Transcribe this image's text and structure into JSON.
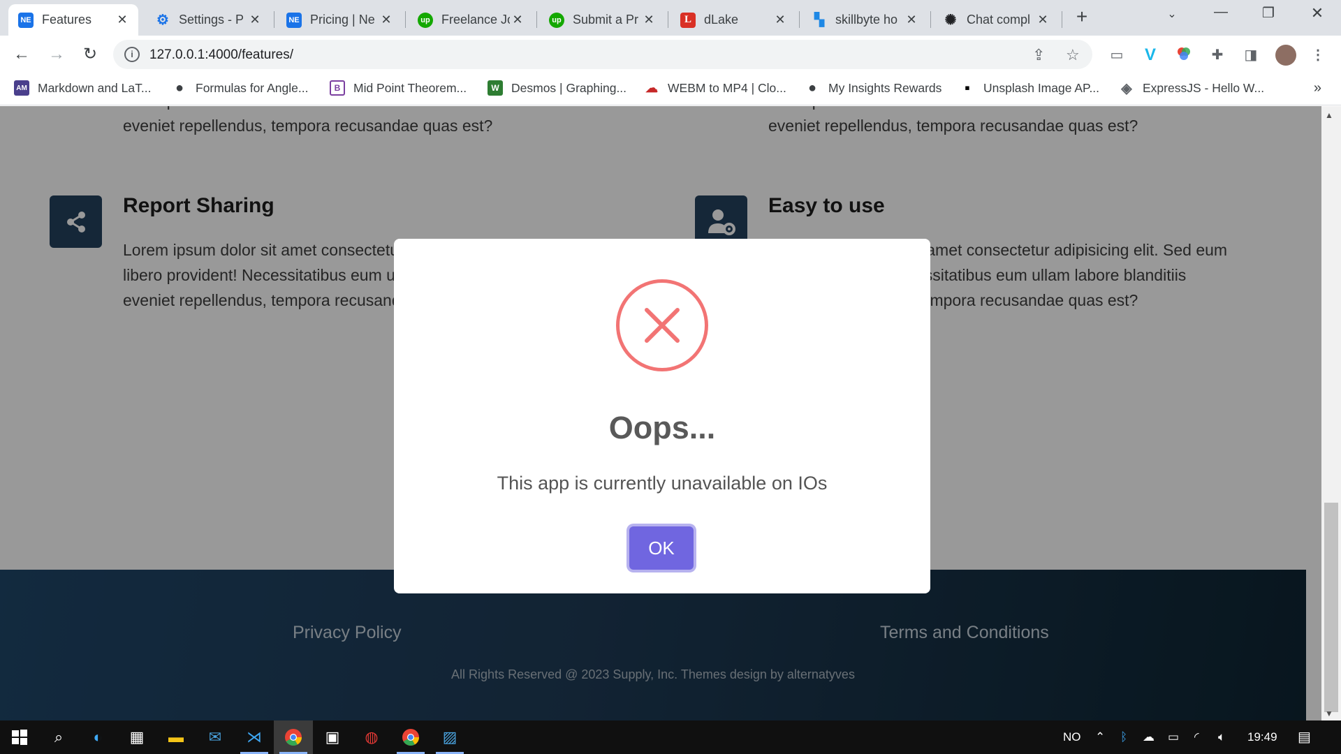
{
  "browser": {
    "tabs": [
      {
        "label": "Features",
        "favicon": "NE",
        "favicon_color": "#1a73e8",
        "active": true
      },
      {
        "label": "Settings - P",
        "favicon": "⚙",
        "favicon_color": "#1a73e8",
        "active": false
      },
      {
        "label": "Pricing | Ne",
        "favicon": "NE",
        "favicon_color": "#1a73e8",
        "active": false
      },
      {
        "label": "Freelance Jo",
        "favicon": "up",
        "favicon_color": "#14a800",
        "active": false
      },
      {
        "label": "Submit a Pr",
        "favicon": "up",
        "favicon_color": "#14a800",
        "active": false
      },
      {
        "label": "dLake",
        "favicon": "L",
        "favicon_color": "#d93025",
        "active": false
      },
      {
        "label": "skillbyte ho",
        "favicon": "▚",
        "favicon_color": "#1e88e5",
        "active": false
      },
      {
        "label": "Chat compl",
        "favicon": "✺",
        "favicon_color": "#202124",
        "active": false
      }
    ],
    "address": "127.0.0.1:4000/features/",
    "bookmarks": [
      {
        "label": "Markdown and LaT...",
        "icon": "AM",
        "icon_color": "#4a3f8c"
      },
      {
        "label": "Formulas for Angle...",
        "icon": "●",
        "icon_color": "#3c4043"
      },
      {
        "label": "Mid Point Theorem...",
        "icon": "B",
        "icon_color": "#7b3fa0"
      },
      {
        "label": "Desmos | Graphing...",
        "icon": "W",
        "icon_color": "#2e7d32"
      },
      {
        "label": "WEBM to MP4 | Clo...",
        "icon": "☁",
        "icon_color": "#c62828"
      },
      {
        "label": "My Insights Rewards",
        "icon": "●",
        "icon_color": "#3c4043"
      },
      {
        "label": "Unsplash Image AP...",
        "icon": "▪",
        "icon_color": "#000000"
      },
      {
        "label": "ExpressJS - Hello W...",
        "icon": "◈",
        "icon_color": "#5f6368"
      }
    ]
  },
  "page": {
    "top_left_partial_line1": "libero provident! Necessitatibus eum ullam labore blanditiis",
    "top_left_partial_line2": "eveniet repellendus, tempora recusandae quas est?",
    "top_right_partial_line1": "libero provident! Necessitatibus eum ullam labore blanditiis",
    "top_right_partial_line2": "eveniet repellendus, tempora recusandae quas est?",
    "features": [
      {
        "title": "Report Sharing",
        "icon": "share-icon",
        "lines": [
          "Lorem ipsum dolor sit amet consectetur adipisicing elit. Sed eum",
          "libero provident! Necessitatibus eum ullam labore blanditiis",
          "eveniet repellendus, tempora recusandae quas est?"
        ]
      },
      {
        "title": "Easy to use",
        "icon": "user-gear-icon",
        "lines": [
          "Lorem ipsum dolor sit amet consectetur adipisicing elit. Sed eum",
          "libero provident! Necessitatibus eum ullam labore blanditiis",
          "eveniet repellendus, tempora recusandae quas est?"
        ]
      }
    ],
    "footer": {
      "privacy": "Privacy Policy",
      "terms": "Terms and Conditions",
      "copyright": "All Rights Reserved @ 2023 Supply, Inc. Themes design by alternatyves"
    }
  },
  "modal": {
    "title": "Oops...",
    "message": "This app is currently unavailable on IOs",
    "ok_label": "OK",
    "icon": "error-x-icon",
    "icon_color": "#f27474",
    "button_color": "#7066e0"
  },
  "taskbar": {
    "language": "NO",
    "time": "19:49"
  }
}
